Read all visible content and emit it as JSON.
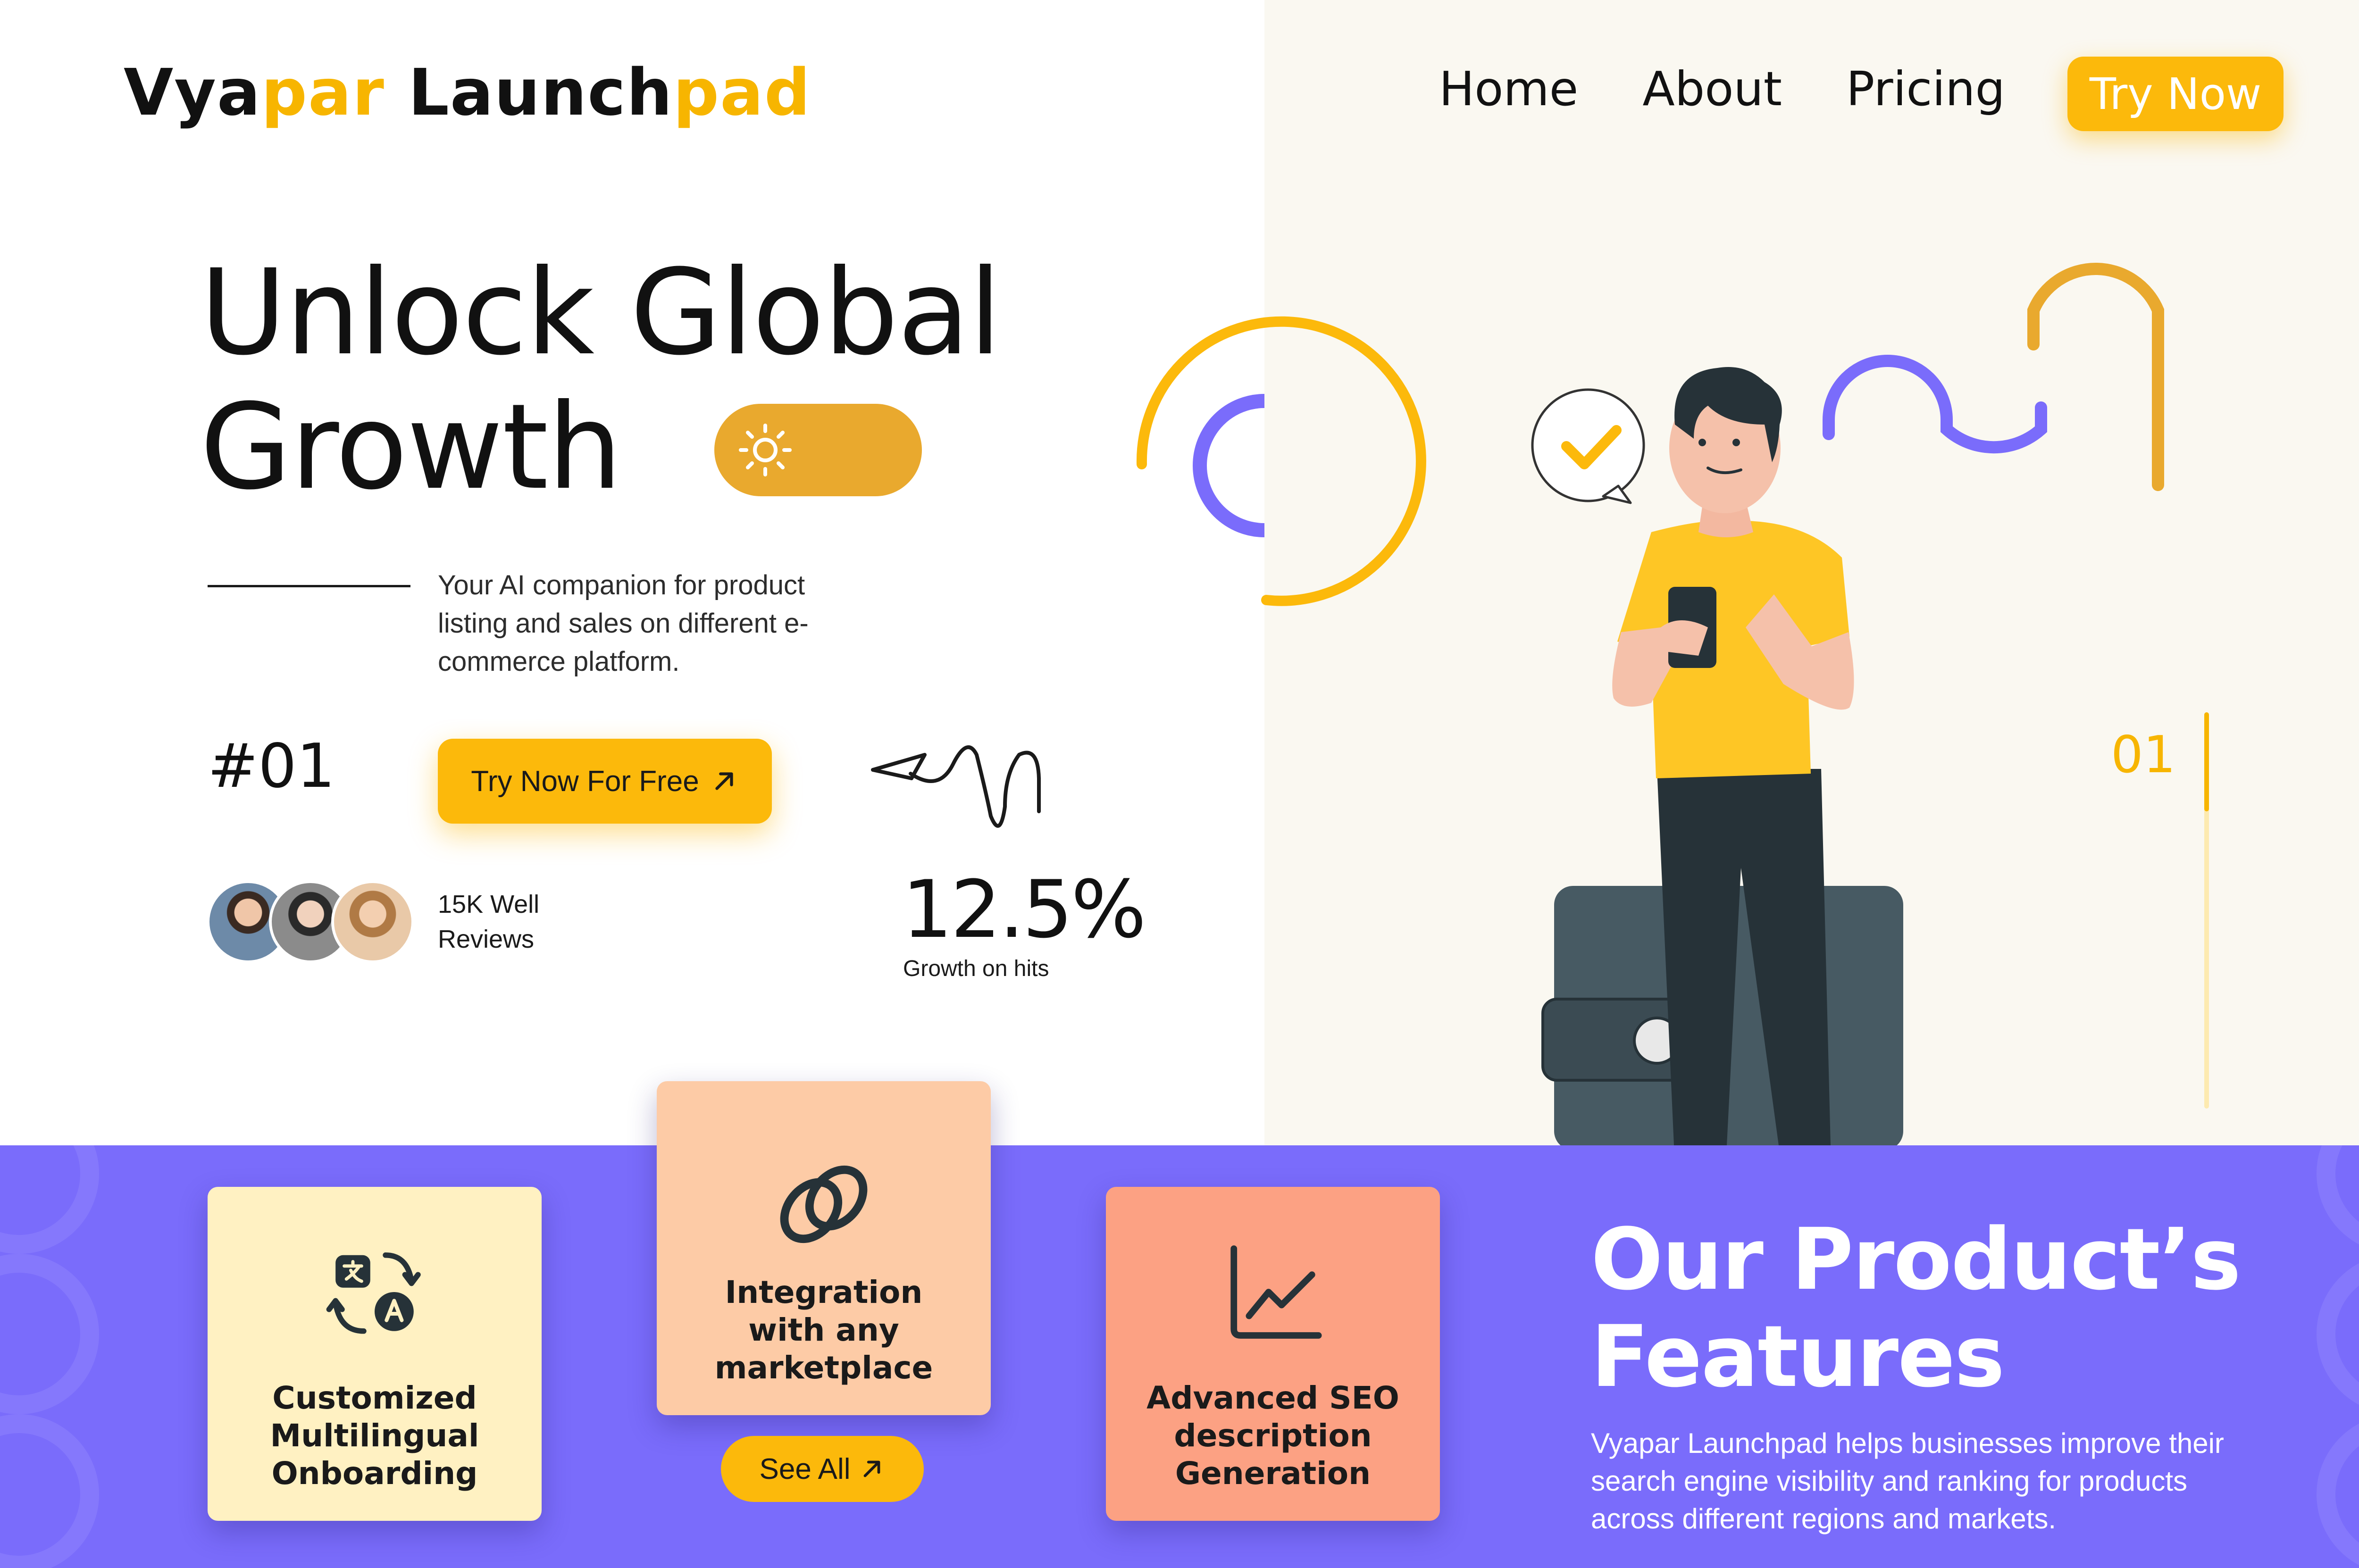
{
  "header": {
    "logo": {
      "part1": "Vya",
      "part2": "par",
      "part3": " Launch",
      "part4": "pad"
    },
    "nav": [
      "Home",
      "About",
      "Pricing"
    ],
    "cta": "Try Now"
  },
  "hero": {
    "title_line1": "Unlock Global",
    "title_line2": "Growth",
    "description": "Your AI companion for product listing and sales on different e-commerce platform.",
    "hash_number": "#01",
    "cta": "Try Now For Free",
    "reviews": "15K Well Reviews",
    "stat_value": "12.5%",
    "stat_label": "Growth on hits",
    "slide_number": "01",
    "slide_progress_fraction": 0.25
  },
  "features": {
    "title": "Our Product’s Features",
    "description": "Vyapar Launchpad helps businesses improve their search engine visibility and ranking for products across different regions and markets.",
    "cards": [
      {
        "label": "Customized Multilingual Onboarding",
        "icon": "translate-icon",
        "color": "#fff1c2"
      },
      {
        "label": "Integration with any marketplace",
        "icon": "link-rings-icon",
        "color": "#fdcba6"
      },
      {
        "label": "Advanced SEO description Generation",
        "icon": "line-chart-icon",
        "color": "#fca183"
      }
    ],
    "see_all": "See All"
  },
  "colors": {
    "accent_yellow": "#fcb90b",
    "purple_band": "#7a6cfb",
    "toggle": "#e9a92e",
    "purple_arc": "#7a6cfb"
  }
}
